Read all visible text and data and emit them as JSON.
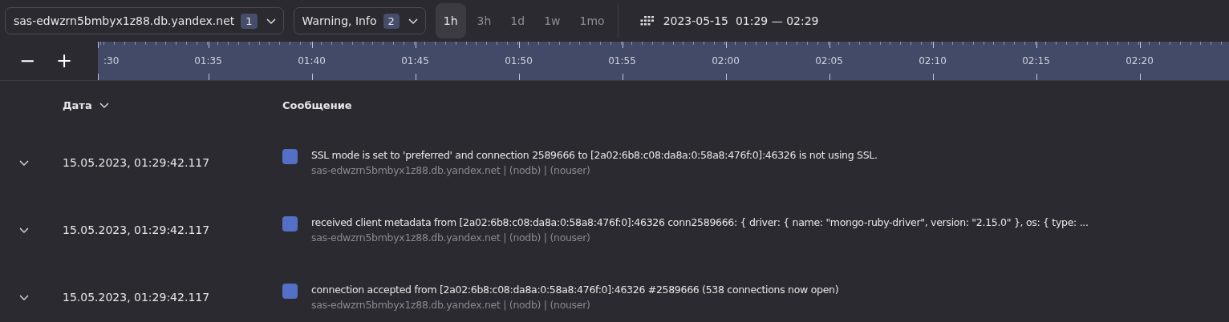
{
  "toolbar": {
    "host_filter": {
      "value": "sas-edwzrn5bmbyx1z88.db.yandex.net",
      "count": "1"
    },
    "level_filter": {
      "value": "Warning, Info",
      "count": "2"
    },
    "periods": [
      {
        "label": "1h",
        "selected": true
      },
      {
        "label": "3h",
        "selected": false
      },
      {
        "label": "1d",
        "selected": false
      },
      {
        "label": "1w",
        "selected": false
      },
      {
        "label": "1mo",
        "selected": false
      }
    ],
    "range": "2023-05-15  01:29 — 02:29"
  },
  "timeline": {
    "zoom_out": "−",
    "zoom_in": "+",
    "labels": [
      ":30",
      "01:35",
      "01:40",
      "01:45",
      "01:50",
      "01:55",
      "02:00",
      "02:05",
      "02:10",
      "02:15",
      "02:20"
    ]
  },
  "table": {
    "columns": [
      {
        "label": "Дата",
        "sortable": true
      },
      {
        "label": "Сообщение"
      }
    ],
    "rows": [
      {
        "expanded": false,
        "date": "15.05.2023, 01:29:42.117",
        "color": "#5470c6",
        "message": "SSL mode is set to 'preferred' and connection 2589666 to [2a02:6b8:c08:da8a:0:58a8:476f:0]:46326 is not using SSL.",
        "meta": "sas-edwzrn5bmbyx1z88.db.yandex.net | (nodb) | (nouser)"
      },
      {
        "expanded": false,
        "date": "15.05.2023, 01:29:42.117",
        "color": "#5470c6",
        "message": "received client metadata from [2a02:6b8:c08:da8a:0:58a8:476f:0]:46326 conn2589666: { driver: { name: \"mongo-ruby-driver\", version: \"2.15.0\" }, os: { type: ...",
        "meta": "sas-edwzrn5bmbyx1z88.db.yandex.net | (nodb) | (nouser)"
      },
      {
        "expanded": false,
        "date": "15.05.2023, 01:29:42.117",
        "color": "#5470c6",
        "message": "connection accepted from [2a02:6b8:c08:da8a:0:58a8:476f:0]:46326 #2589666 (538 connections now open)",
        "meta": "sas-edwzrn5bmbyx1z88.db.yandex.net | (nodb) | (nouser)"
      }
    ]
  }
}
